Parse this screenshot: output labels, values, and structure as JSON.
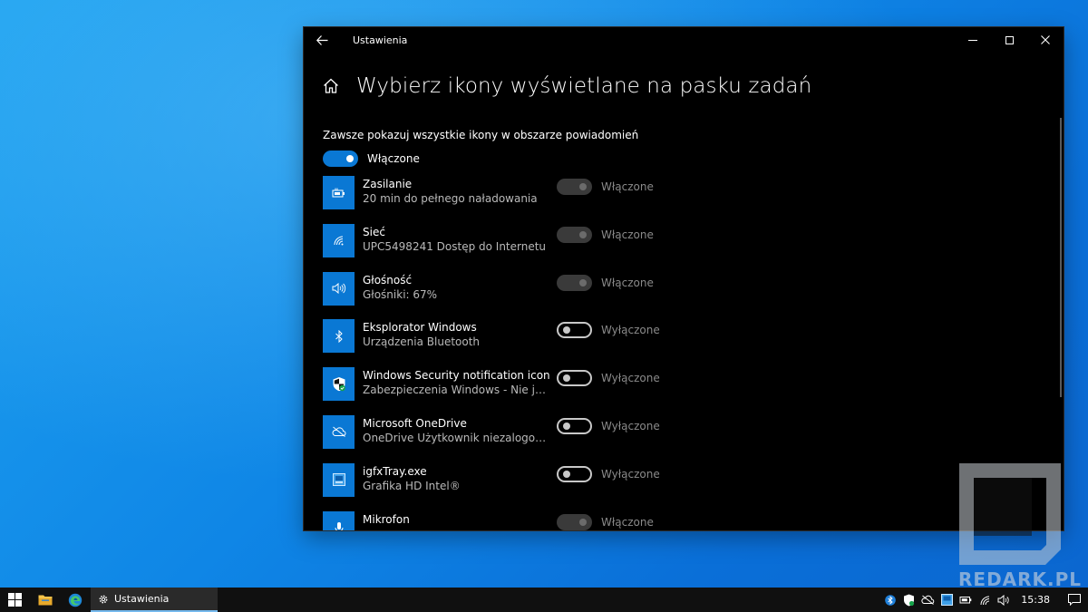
{
  "window": {
    "title": "Ustawienia",
    "page_title": "Wybierz ikony wyświetlane na pasku zadań"
  },
  "always_show": {
    "label": "Zawsze pokazuj wszystkie ikony w obszarze powiadomień",
    "state_label": "Włączone",
    "on": true
  },
  "items": [
    {
      "name": "Zasilanie",
      "sub": "20 min do pełnego naładowania",
      "state": "Włączone",
      "toggle": "disabled",
      "icon": "battery-icon"
    },
    {
      "name": "Sieć",
      "sub": "UPC5498241 Dostęp do Internetu",
      "state": "Włączone",
      "toggle": "disabled",
      "icon": "wifi-icon"
    },
    {
      "name": "Głośność",
      "sub": "Głośniki: 67%",
      "state": "Włączone",
      "toggle": "disabled",
      "icon": "speaker-icon"
    },
    {
      "name": "Eksplorator Windows",
      "sub": "Urządzenia Bluetooth",
      "state": "Wyłączone",
      "toggle": "off",
      "icon": "bluetooth-icon"
    },
    {
      "name": "Windows Security notification icon",
      "sub": "Zabezpieczenia Windows - Nie jest...",
      "state": "Wyłączone",
      "toggle": "off",
      "icon": "shield-icon"
    },
    {
      "name": "Microsoft OneDrive",
      "sub": "OneDrive Użytkownik niezalogowany",
      "state": "Wyłączone",
      "toggle": "off",
      "icon": "cloud-offline-icon"
    },
    {
      "name": "igfxTray.exe",
      "sub": "Grafika HD Intel®",
      "state": "Wyłączone",
      "toggle": "off",
      "icon": "intel-graphics-icon"
    },
    {
      "name": "Mikrofon",
      "sub": "",
      "state": "Włączone",
      "toggle": "disabled",
      "icon": "microphone-icon"
    }
  ],
  "taskbar": {
    "app_label": "Ustawienia",
    "clock": "15:38"
  },
  "watermark": {
    "text": "REDARK.PL"
  },
  "colors": {
    "accent": "#0a78d4",
    "window_bg": "#000000",
    "taskbar_bg": "#101010"
  }
}
